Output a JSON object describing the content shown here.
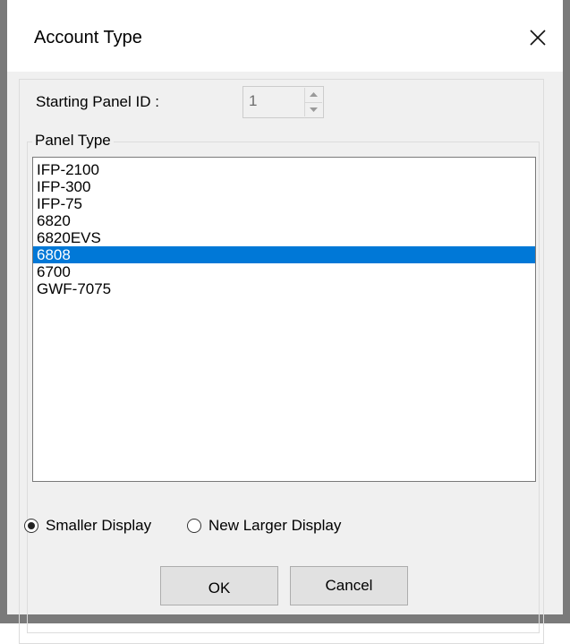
{
  "window": {
    "title": "Account Type",
    "close_icon": "close-icon"
  },
  "starting_panel": {
    "label": "Starting Panel ID :",
    "value": "1"
  },
  "panel_type": {
    "group_label": "Panel Type",
    "items": [
      "IFP-2100",
      "IFP-300",
      "IFP-75",
      "6820",
      "6820EVS",
      "6808",
      "6700",
      "GWF-7075"
    ],
    "selected": "6808"
  },
  "display_options": {
    "options": [
      {
        "label": "Smaller Display",
        "checked": true
      },
      {
        "label": "New Larger Display",
        "checked": false
      }
    ]
  },
  "buttons": {
    "ok": "OK",
    "cancel": "Cancel"
  },
  "colors": {
    "selection": "#0078d7",
    "window_border": "#7a7a7a",
    "dialog_background": "#f0f0f0"
  }
}
